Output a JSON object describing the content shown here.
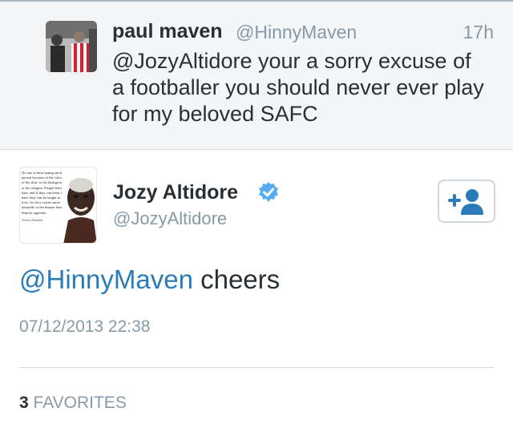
{
  "reply_context": {
    "name": "paul maven",
    "handle": "@HinnyMaven",
    "time": "17h",
    "text": "@JozyAltidore your a sorry excuse of a footballer you should never ever play for my beloved SAFC"
  },
  "main_tweet": {
    "name": "Jozy Altidore",
    "handle": "@JozyAltidore",
    "verified_icon": "verified-badge-icon",
    "follow_icon": "add-user-icon",
    "avatar_quote": "No one is born hating another person because of the colour of his skin, or his background or his religion. People learn to hate, and if they can learn to hate, they can be taught to love, for love comes more naturally to the human heart than its opposite.",
    "avatar_quote_attribution": "Nelson Mandela",
    "text_mention": "@HinnyMaven",
    "text_rest": " cheers",
    "timestamp": "07/12/2013 22:38",
    "favorites_count": "3",
    "favorites_label": " FAVORITES"
  },
  "colors": {
    "link_blue": "#2b7bb9",
    "verified_blue": "#55acee",
    "muted_gray": "#8899a6",
    "context_bg": "#f4f5f7"
  }
}
